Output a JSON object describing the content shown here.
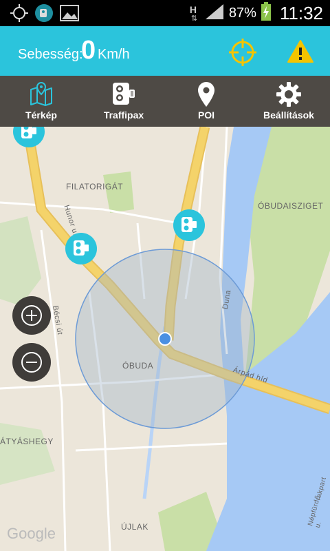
{
  "status_bar": {
    "battery_percent": "87%",
    "clock": "11:32",
    "network_letter": "H"
  },
  "speed_header": {
    "label": "Sebesség:",
    "value": "0",
    "unit": "Km/h"
  },
  "tabs": [
    {
      "label": "Térkép",
      "icon": "map-icon"
    },
    {
      "label": "Traffipax",
      "icon": "speed-camera-icon"
    },
    {
      "label": "POI",
      "icon": "location-pin-icon"
    },
    {
      "label": "Beállítások",
      "icon": "gear-icon"
    }
  ],
  "map": {
    "labels": {
      "filatorigat": "FILATORIGÁT",
      "obudaisziget": "ÓBUDAISZIGET",
      "hunor": "Hunor u.",
      "becsi": "Bécsi út",
      "duna": "Duna",
      "obuda": "ÓBUDA",
      "arpad": "Árpád híd",
      "hegy": "ÁTYÁSHEGY",
      "ujlak": "ÚJLAK",
      "neptfurdo": "Népfürdő u.",
      "rakpart": "rakpart"
    },
    "attribution": "Google"
  },
  "colors": {
    "accent": "#2bc4dc",
    "nav_bg": "#4e4a45",
    "warning": "#f5c400",
    "road": "#f4d36a",
    "water": "#a6c9f5",
    "park": "#c9dfa7"
  }
}
